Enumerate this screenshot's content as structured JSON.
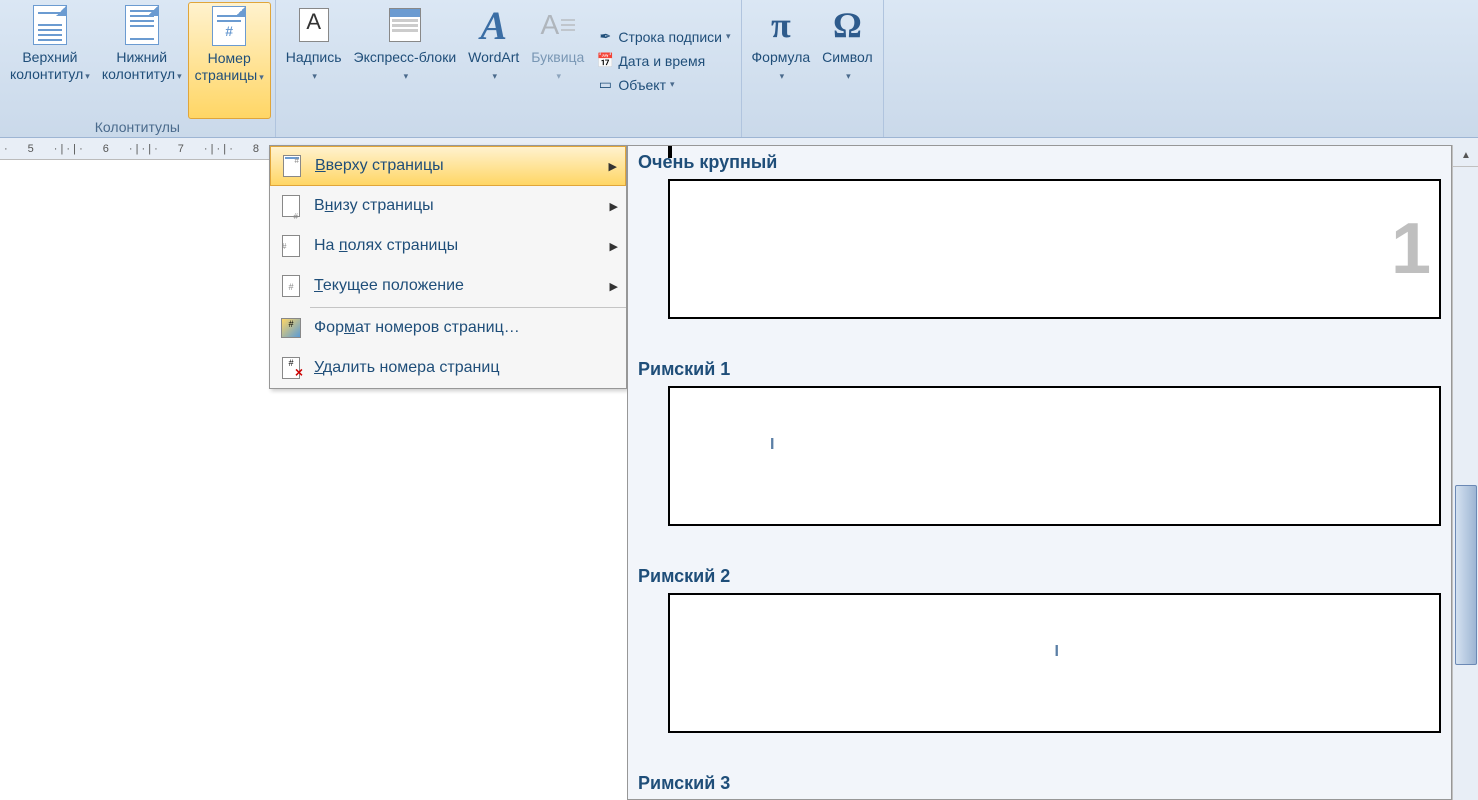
{
  "ribbon": {
    "groups": {
      "headers": {
        "title": "Колонтитулы",
        "items": [
          {
            "label": "Верхний\nколонтитул",
            "dd": true
          },
          {
            "label": "Нижний\nколонтитул",
            "dd": true
          },
          {
            "label": "Номер\nстраницы",
            "dd": true,
            "selected": true
          }
        ]
      },
      "text": {
        "items": [
          {
            "label": "Надпись",
            "dd": true
          },
          {
            "label": "Экспресс-блоки",
            "dd": true
          },
          {
            "label": "WordArt",
            "dd": true
          },
          {
            "label": "Буквица",
            "dd": true,
            "disabled": true
          }
        ],
        "small": [
          {
            "label": "Строка подписи",
            "dd": true,
            "icon": "signature"
          },
          {
            "label": "Дата и время",
            "icon": "calendar"
          },
          {
            "label": "Объект",
            "dd": true,
            "icon": "object"
          }
        ]
      },
      "symbols": {
        "items": [
          {
            "label": "Формула",
            "dd": true,
            "icon": "pi"
          },
          {
            "label": "Символ",
            "dd": true,
            "icon": "omega"
          }
        ]
      }
    }
  },
  "ruler": [
    "5",
    "6",
    "7",
    "8"
  ],
  "menu": [
    {
      "label": "Вверху страницы",
      "u": "В",
      "arrow": true,
      "hover": true,
      "icon": "page-top"
    },
    {
      "label": "Внизу страницы",
      "u": "н",
      "arrow": true,
      "icon": "page-bottom"
    },
    {
      "label": "На полях страницы",
      "u": "п",
      "arrow": true,
      "icon": "page-margin"
    },
    {
      "label": "Текущее положение",
      "u": "Т",
      "arrow": true,
      "icon": "page-current"
    },
    {
      "sep": true
    },
    {
      "label": "Формат номеров страниц…",
      "u": "м",
      "icon": "format"
    },
    {
      "label": "Удалить номера страниц",
      "u": "У",
      "icon": "delete"
    }
  ],
  "gallery": [
    {
      "title": "Очень крупный",
      "type": "big1"
    },
    {
      "title": "Римский 1",
      "type": "roman",
      "pos": "left"
    },
    {
      "title": "Римский 2",
      "type": "roman",
      "pos": "center"
    },
    {
      "title": "Римский 3",
      "type": "roman_partial"
    }
  ]
}
